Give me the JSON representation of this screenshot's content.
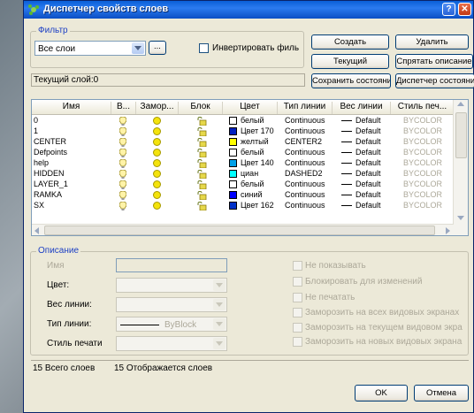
{
  "title": "Диспетчер свойств слоев",
  "titlebar": {
    "help": "?",
    "close": "✕"
  },
  "filter": {
    "group_label": "Фильтр",
    "combo_value": "Все слои",
    "browse_label": "...",
    "invert_label": "Инвертировать филь"
  },
  "buttons": {
    "create": "Создать",
    "delete": "Удалить",
    "current": "Текущий",
    "hide_desc": "Спрятать описание",
    "save_state": "Сохранить состояние",
    "state_manager": "Диспетчер состояний",
    "ok": "OK",
    "cancel": "Отмена"
  },
  "current_layer": "Текущий слой:0",
  "columns": [
    "Имя",
    "В...",
    "Замор...",
    "Блок",
    "Цвет",
    "Тип линии",
    "Вес линии",
    "Стиль печ..."
  ],
  "layers": [
    {
      "name": "0",
      "color_name": "белый",
      "color": "#ffffff",
      "linetype": "Continuous",
      "weight": "Default",
      "plot": "BYCOLOR"
    },
    {
      "name": "1",
      "color_name": "Цвет 170",
      "color": "#0020c0",
      "linetype": "Continuous",
      "weight": "Default",
      "plot": "BYCOLOR"
    },
    {
      "name": "CENTER",
      "color_name": "желтый",
      "color": "#ffff00",
      "linetype": "CENTER2",
      "weight": "Default",
      "plot": "BYCOLOR"
    },
    {
      "name": "Defpoints",
      "color_name": "белый",
      "color": "#ffffff",
      "linetype": "Continuous",
      "weight": "Default",
      "plot": "BYCOLOR"
    },
    {
      "name": "help",
      "color_name": "Цвет 140",
      "color": "#00a0e8",
      "linetype": "Continuous",
      "weight": "Default",
      "plot": "BYCOLOR"
    },
    {
      "name": "HIDDEN",
      "color_name": "циан",
      "color": "#00ffff",
      "linetype": "DASHED2",
      "weight": "Default",
      "plot": "BYCOLOR"
    },
    {
      "name": "LAYER_1",
      "color_name": "белый",
      "color": "#ffffff",
      "linetype": "Continuous",
      "weight": "Default",
      "plot": "BYCOLOR"
    },
    {
      "name": "RAMKA",
      "color_name": "синий",
      "color": "#0000ff",
      "linetype": "Continuous",
      "weight": "Default",
      "plot": "BYCOLOR"
    },
    {
      "name": "SX",
      "color_name": "Цвет 162",
      "color": "#0030c8",
      "linetype": "Continuous",
      "weight": "Default",
      "plot": "BYCOLOR"
    }
  ],
  "description": {
    "group_label": "Описание",
    "name_label": "Имя",
    "color_label": "Цвет:",
    "weight_label": "Вес линии:",
    "linetype_label": "Тип линии:",
    "linetype_value": "ByBlock",
    "plotstyle_label": "Стиль печати",
    "options": [
      "Не показывать",
      "Блокировать для изменений",
      "Не печатать",
      "Заморозить на всех видовых экранах",
      "Заморозить на текущем видовом экра",
      "Заморозить на новых видовых экрана"
    ]
  },
  "status": {
    "total": "15 Всего слоев",
    "shown": "15 Отображается слоев"
  },
  "colors": {
    "accent": "#1c3fc4",
    "titlebar": "#0a5fd8",
    "background": "#ece9d8"
  }
}
